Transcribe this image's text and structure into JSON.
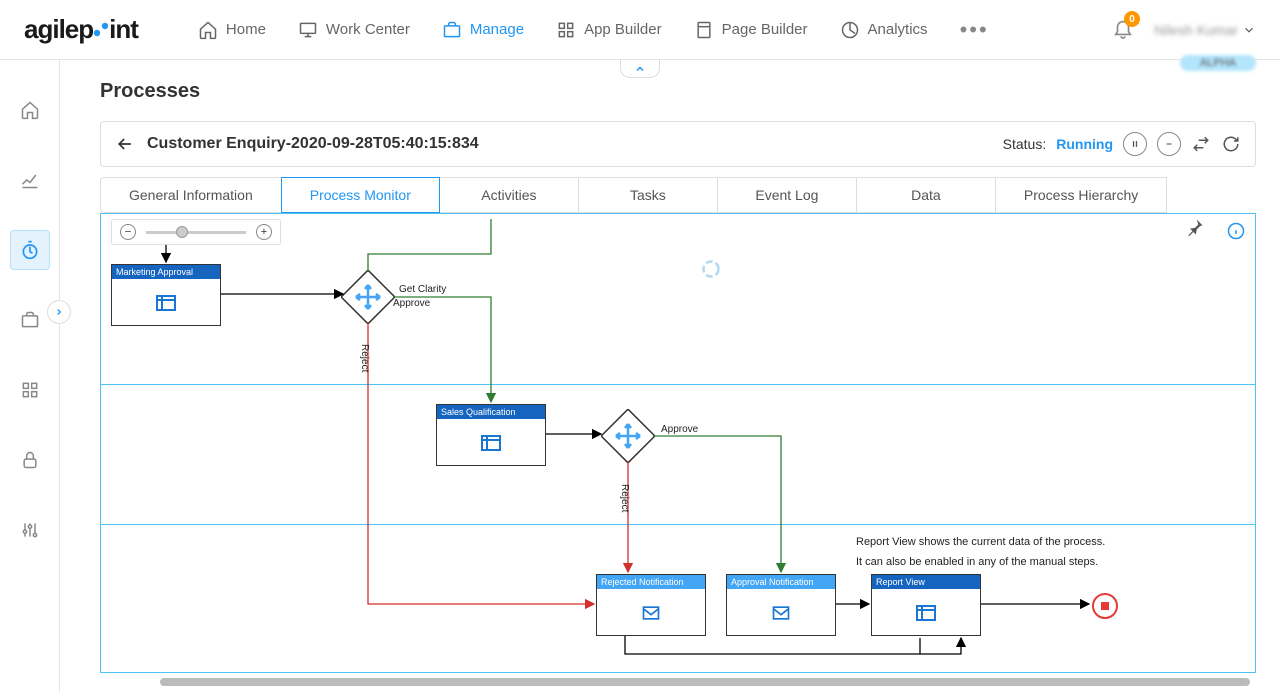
{
  "header": {
    "brand_a": "agilep",
    "brand_b": "int",
    "nav": {
      "home": "Home",
      "workcenter": "Work Center",
      "manage": "Manage",
      "appbuilder": "App Builder",
      "pagebuilder": "Page Builder",
      "analytics": "Analytics"
    },
    "notification_count": "0",
    "user_name": "Nilesh Kumar",
    "alpha": "ALPHA"
  },
  "page": {
    "title": "Processes",
    "detail_title": "Customer Enquiry-2020-09-28T05:40:15:834",
    "status_label": "Status:",
    "status_value": "Running"
  },
  "tabs": {
    "general": "General Information",
    "monitor": "Process Monitor",
    "activities": "Activities",
    "tasks": "Tasks",
    "eventlog": "Event Log",
    "data": "Data",
    "hierarchy": "Process Hierarchy"
  },
  "flow": {
    "marketing": "Marketing Approval",
    "sales": "Sales Qualification",
    "rejected": "Rejected Notification",
    "approval": "Approval Notification",
    "report": "Report View",
    "get_clarity": "Get Clarity",
    "approve1": "Approve",
    "reject1": "Reject",
    "approve2": "Approve",
    "reject2": "Reject",
    "note1": "Report View shows the current data of the process.",
    "note2": "It can also be enabled in any of the manual steps."
  }
}
